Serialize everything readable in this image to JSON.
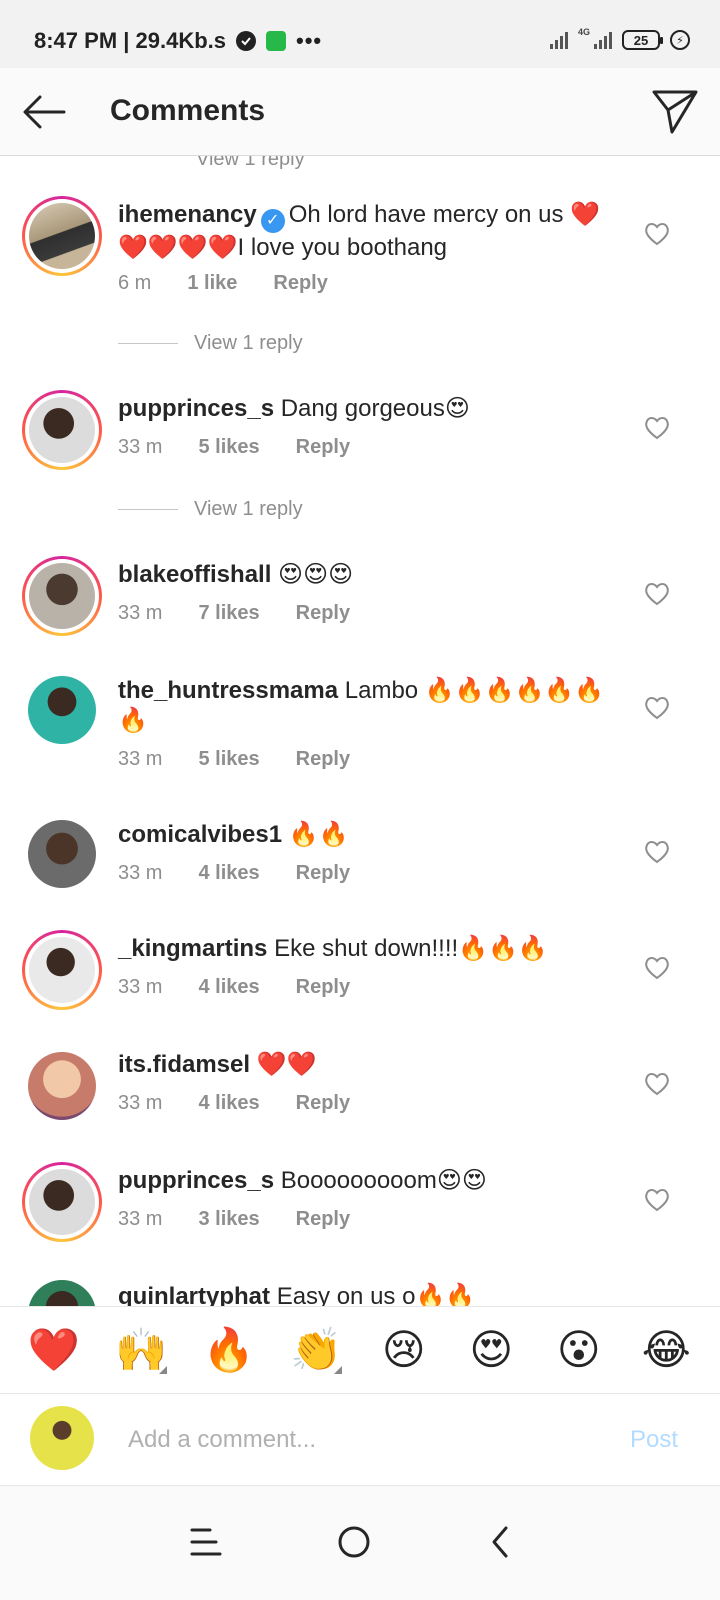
{
  "status_bar": {
    "time_speed": "8:47 PM | 29.4Kb.s",
    "network": "4G",
    "battery": "25"
  },
  "header": {
    "title": "Comments"
  },
  "cut_view_reply": "View 1 reply",
  "comments": [
    {
      "username": "ihemenancy",
      "verified": true,
      "text": "Oh lord have mercy on us ❤️❤️❤️❤️❤️I love you boothang",
      "time": "6 m",
      "likes": "1 like",
      "reply": "Reply",
      "view_reply": "View 1 reply"
    },
    {
      "username": "pupprinces_s",
      "text": "Dang gorgeous😍",
      "time": "33 m",
      "likes": "5 likes",
      "reply": "Reply",
      "view_reply": "View 1 reply"
    },
    {
      "username": "blakeoffishall",
      "text": "😍😍😍",
      "time": "33 m",
      "likes": "7 likes",
      "reply": "Reply"
    },
    {
      "username": "the_huntressmama",
      "text": "Lambo 🔥🔥🔥🔥🔥🔥🔥",
      "time": "33 m",
      "likes": "5 likes",
      "reply": "Reply"
    },
    {
      "username": "comicalvibes1",
      "text": "🔥🔥",
      "time": "33 m",
      "likes": "4 likes",
      "reply": "Reply"
    },
    {
      "username": "_kingmartins",
      "text": "Eke shut down!!!!🔥🔥🔥",
      "time": "33 m",
      "likes": "4 likes",
      "reply": "Reply"
    },
    {
      "username": "its.fidamsel",
      "text": "❤️❤️",
      "time": "33 m",
      "likes": "4 likes",
      "reply": "Reply"
    },
    {
      "username": "pupprinces_s",
      "text": "Booooooooom😍😍",
      "time": "33 m",
      "likes": "3 likes",
      "reply": "Reply"
    },
    {
      "username": "quinlartyphat",
      "text": "Easy on us o🔥🔥"
    }
  ],
  "emoji_bar": [
    "❤️",
    "🙌",
    "🔥",
    "👏",
    "😢",
    "😍",
    "😮",
    "😂"
  ],
  "composer": {
    "placeholder": "Add a comment...",
    "post_label": "Post"
  }
}
